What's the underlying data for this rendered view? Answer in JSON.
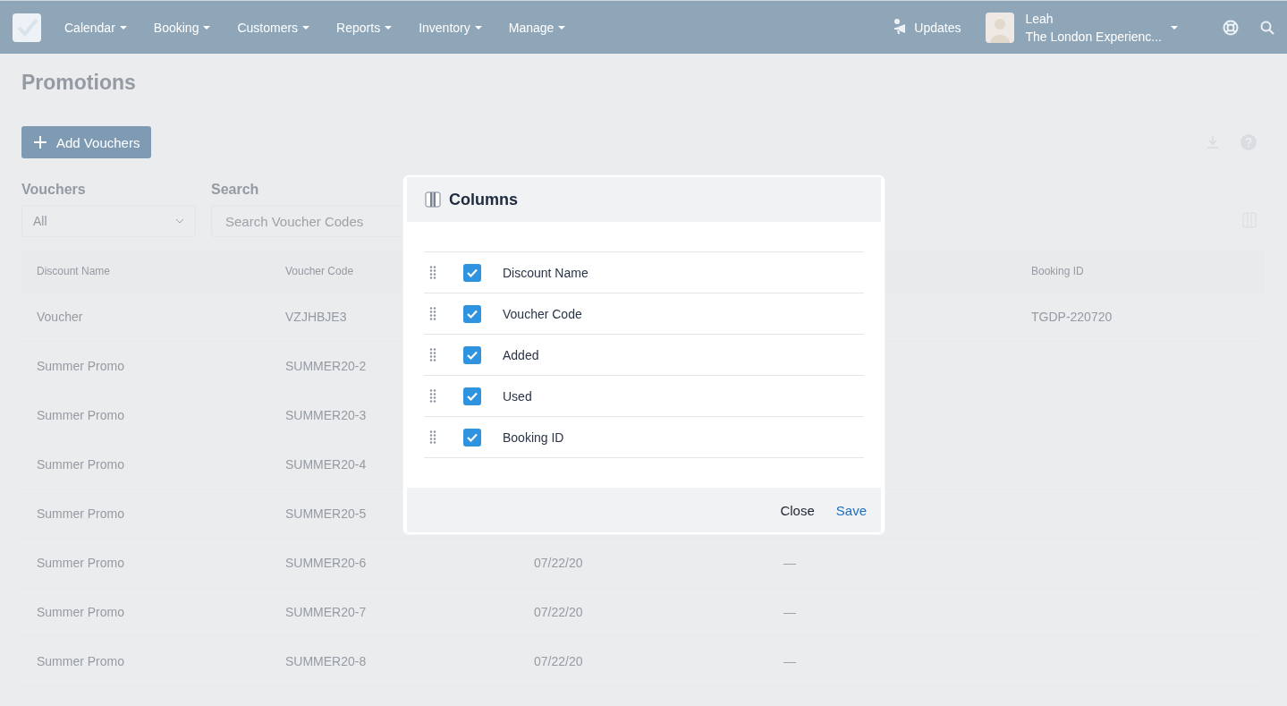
{
  "nav": {
    "items": [
      {
        "label": "Calendar"
      },
      {
        "label": "Booking"
      },
      {
        "label": "Customers"
      },
      {
        "label": "Reports"
      },
      {
        "label": "Inventory"
      },
      {
        "label": "Manage"
      }
    ],
    "updates": "Updates",
    "user": {
      "name": "Leah",
      "company": "The London Experienc..."
    }
  },
  "page": {
    "title": "Promotions",
    "add_button": "Add Vouchers"
  },
  "filters": {
    "vouchers": {
      "label": "Vouchers",
      "value": "All"
    },
    "search": {
      "label": "Search",
      "placeholder": "Search Voucher Codes"
    }
  },
  "table": {
    "columns": [
      "Discount Name",
      "Voucher Code",
      null,
      null,
      "Booking ID"
    ],
    "rows": [
      {
        "cells": [
          "Voucher",
          "VZJHBJE3",
          null,
          null,
          "TGDP-220720"
        ]
      },
      {
        "cells": [
          "Summer Promo",
          "SUMMER20-2",
          null,
          null,
          null
        ]
      },
      {
        "cells": [
          "Summer Promo",
          "SUMMER20-3",
          null,
          null,
          null
        ]
      },
      {
        "cells": [
          "Summer Promo",
          "SUMMER20-4",
          null,
          null,
          null
        ]
      },
      {
        "cells": [
          "Summer Promo",
          "SUMMER20-5",
          null,
          null,
          null
        ]
      },
      {
        "cells": [
          "Summer Promo",
          "SUMMER20-6",
          "07/22/20",
          "—",
          null
        ]
      },
      {
        "cells": [
          "Summer Promo",
          "SUMMER20-7",
          "07/22/20",
          "—",
          null
        ]
      },
      {
        "cells": [
          "Summer Promo",
          "SUMMER20-8",
          "07/22/20",
          "—",
          null
        ]
      }
    ]
  },
  "modal": {
    "title": "Columns",
    "items": [
      {
        "label": "Discount Name",
        "checked": true
      },
      {
        "label": "Voucher Code",
        "checked": true
      },
      {
        "label": "Added",
        "checked": true
      },
      {
        "label": "Used",
        "checked": true
      },
      {
        "label": "Booking ID",
        "checked": true
      }
    ],
    "buttons": [
      {
        "label": "Close",
        "kind": "secondary"
      },
      {
        "label": "Save",
        "kind": "primary"
      }
    ]
  }
}
